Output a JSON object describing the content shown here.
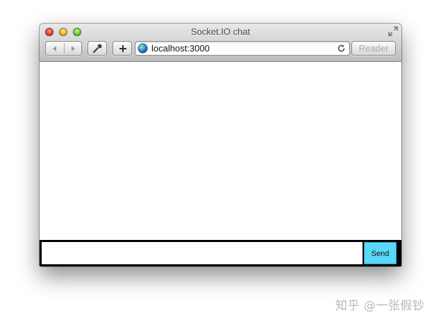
{
  "window": {
    "title": "Socket.IO chat"
  },
  "toolbar": {
    "address": "localhost:3000",
    "reader_label": "Reader",
    "icons": {
      "back": "chevron-left-icon",
      "forward": "chevron-right-icon",
      "tools": "wrench-icon",
      "add": "plus-icon",
      "site": "globe-icon",
      "reload": "reload-icon",
      "fullscreen": "fullscreen-icon"
    }
  },
  "chat": {
    "messages": [],
    "input_value": "",
    "send_label": "Send",
    "send_color": "#5ad8f8"
  },
  "watermark": "知乎 @一张假钞"
}
